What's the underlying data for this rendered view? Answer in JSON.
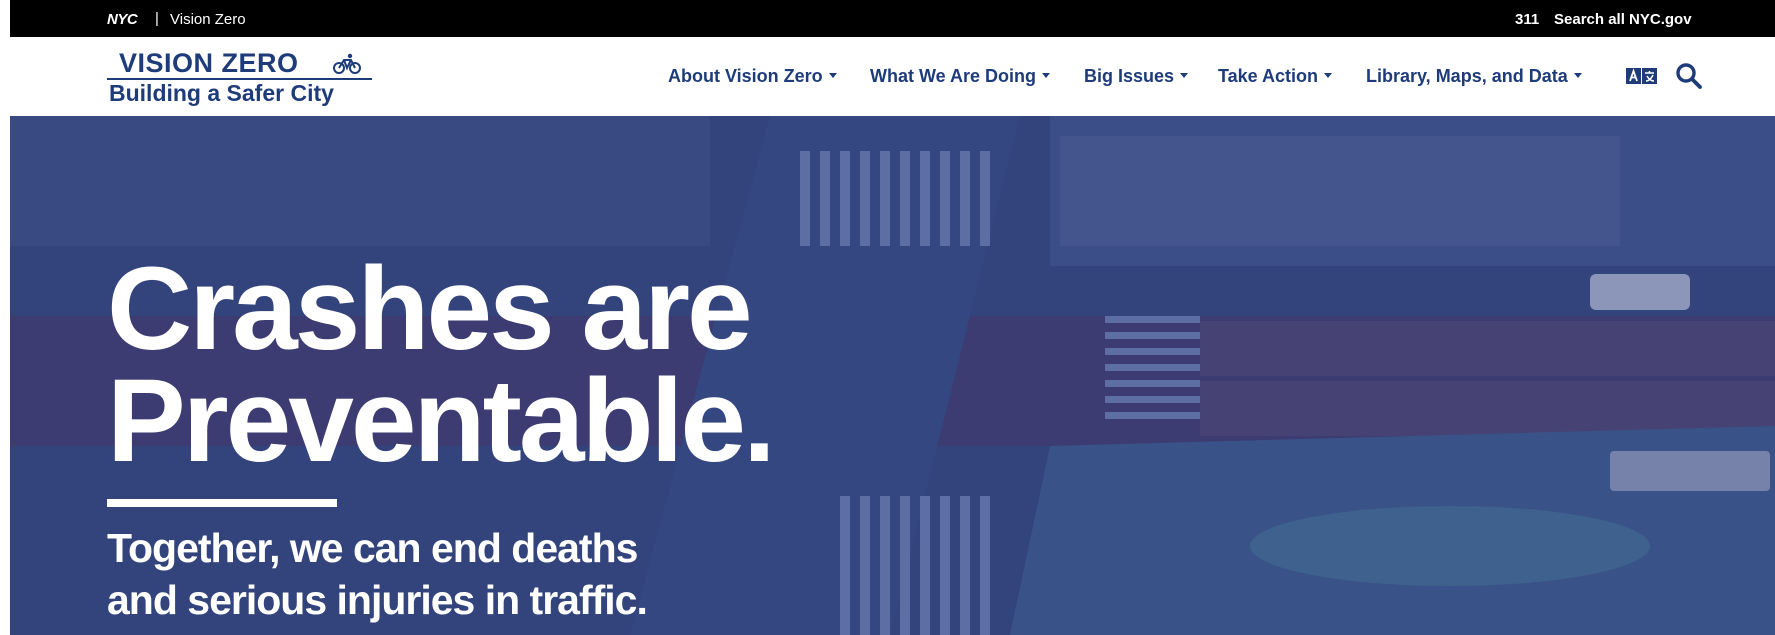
{
  "topbar": {
    "logo_text": "NYC",
    "separator": "|",
    "site_link": "Vision Zero",
    "link_311": "311",
    "search_all": "Search all NYC.gov"
  },
  "brand": {
    "title": "VISION ZERO",
    "tagline": "Building a Safer City",
    "color": "#1e3b7a"
  },
  "nav": {
    "items": [
      {
        "label": "About Vision Zero"
      },
      {
        "label": "What We Are Doing"
      },
      {
        "label": "Big Issues"
      },
      {
        "label": "Take Action"
      },
      {
        "label": "Library, Maps, and Data"
      }
    ],
    "translate_icon": "translate-icon",
    "search_icon": "search-icon"
  },
  "hero": {
    "headline_line1": "Crashes are",
    "headline_line2": "Preventable.",
    "subhead_line1": "Together, we can end deaths",
    "subhead_line2": "and serious injuries in traffic.",
    "overlay_color": "#2b3c78",
    "background": "aerial-street-photo"
  }
}
